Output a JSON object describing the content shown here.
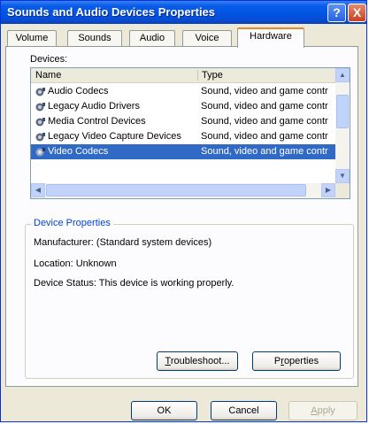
{
  "window": {
    "title": "Sounds and Audio Devices Properties",
    "help_glyph": "?",
    "close_glyph": "X"
  },
  "tabs": [
    {
      "label": "Volume",
      "active": false
    },
    {
      "label": "Sounds",
      "active": false
    },
    {
      "label": "Audio",
      "active": false
    },
    {
      "label": "Voice",
      "active": false
    },
    {
      "label": "Hardware",
      "active": true
    }
  ],
  "devices": {
    "label": "Devices:",
    "columns": {
      "name": "Name",
      "type": "Type"
    },
    "rows": [
      {
        "name": "Audio Codecs",
        "type": "Sound, video and game contr",
        "selected": false
      },
      {
        "name": "Legacy Audio Drivers",
        "type": "Sound, video and game contr",
        "selected": false
      },
      {
        "name": "Media Control Devices",
        "type": "Sound, video and game contr",
        "selected": false
      },
      {
        "name": "Legacy Video Capture Devices",
        "type": "Sound, video and game contr",
        "selected": false
      },
      {
        "name": "Video Codecs",
        "type": "Sound, video and game contr",
        "selected": true
      }
    ]
  },
  "device_properties": {
    "legend": "Device Properties",
    "manufacturer": "Manufacturer: (Standard system devices)",
    "location": "Location: Unknown",
    "status": "Device Status: This device is working properly."
  },
  "buttons": {
    "troubleshoot": {
      "mnemonic": "T",
      "rest": "roubleshoot..."
    },
    "properties": {
      "pre": "P",
      "mnemonic": "r",
      "rest": "operties"
    },
    "ok": "OK",
    "cancel": "Cancel",
    "apply": {
      "mnemonic": "A",
      "rest": "pply"
    }
  },
  "colors": {
    "title_bar": "#0054e3",
    "selection": "#316ac5",
    "active_tab_accent": "#e68b2c",
    "group_legend": "#0046d5"
  }
}
